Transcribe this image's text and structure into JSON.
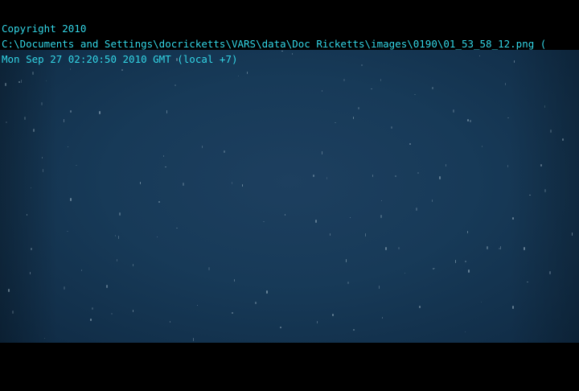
{
  "overlay": {
    "copyright": "Copyright 2010",
    "file_path": "C:\\Documents and Settings\\docricketts\\VARS\\data\\Doc Ricketts\\images\\0190\\01_53_58_12.png (",
    "timestamp": "Mon Sep 27 02:20:50 2010 GMT (local +7)"
  },
  "colors": {
    "overlay_text": "#33d6e6",
    "water": "#173a58",
    "letterbox": "#000000"
  }
}
